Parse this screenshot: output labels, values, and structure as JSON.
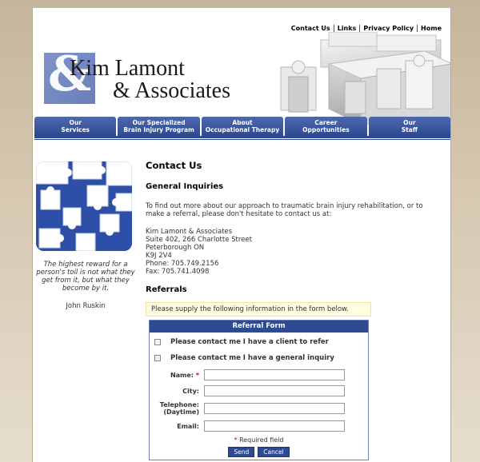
{
  "top_links": [
    "Contact Us",
    "Links",
    "Privacy Policy",
    "Home"
  ],
  "logo": {
    "amp": "&",
    "line1": "Kim Lamont",
    "line2": "& Associates"
  },
  "nav": [
    {
      "line1": "Our",
      "line2": "Services"
    },
    {
      "line1": "Our Specialized",
      "line2": "Brain Injury Program"
    },
    {
      "line1": "About",
      "line2": "Occupational Therapy"
    },
    {
      "line1": "Career",
      "line2": "Opportunities"
    },
    {
      "line1": "Our",
      "line2": "Staff"
    }
  ],
  "sidebar": {
    "quote": "The highest reward for a person's toil is not what they get from it, but what they become by it.",
    "author": "John Ruskin"
  },
  "main": {
    "title": "Contact Us",
    "general_heading": "General Inquiries",
    "intro": "To find out more about our approach to traumatic brain injury rehabilitation, or to make a referral, please don't hesitate to contact us at:",
    "address": [
      "Kim Lamont & Associates",
      "Suite 402, 266 Charlotte Street",
      "Peterborough ON",
      "K9J 2V4",
      "Phone: 705.749.2156",
      "Fax: 705.741.4098"
    ],
    "referrals_heading": "Referrals",
    "notice": "Please supply the following information in the form below."
  },
  "form": {
    "title": "Referral Form",
    "check_client": "Please contact me I have a client to refer",
    "check_general": "Please contact me I have a general inquiry",
    "name_label": "Name:",
    "required_mark": "*",
    "city_label": "City:",
    "phone_label_1": "Telephone:",
    "phone_label_2": "(Daytime)",
    "email_label": "Email:",
    "required_note": "Required field",
    "send": "Send",
    "cancel": "Cancel"
  },
  "colors": {
    "brand_blue": "#2e4a93",
    "logo_blue": "#7f93c8",
    "notice_bg": "#fffee0"
  }
}
